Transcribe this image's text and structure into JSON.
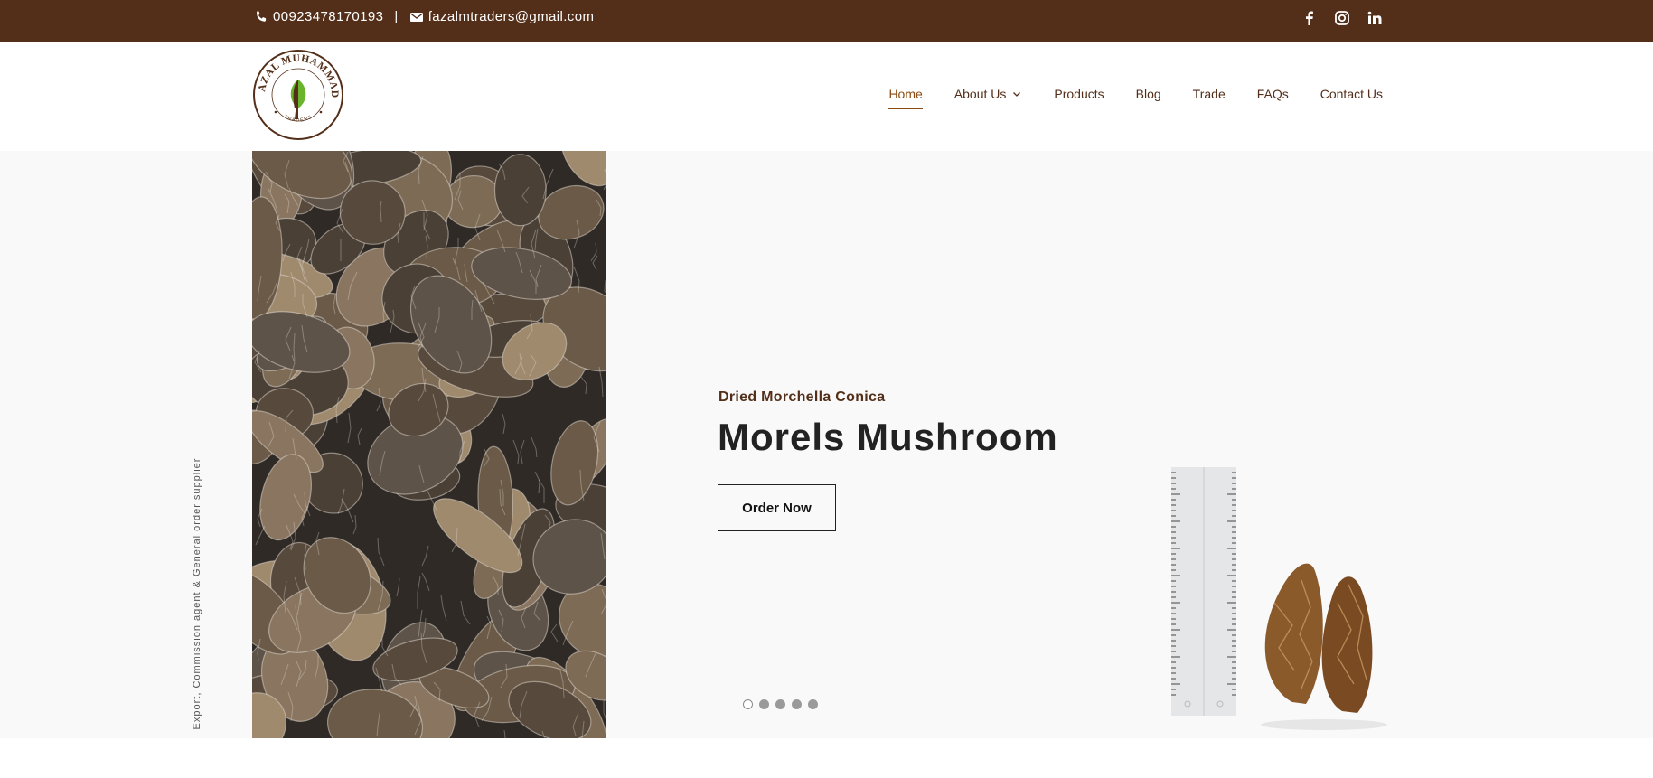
{
  "topbar": {
    "phone": "00923478170193",
    "separator": "|",
    "email": "fazalmtraders@gmail.com",
    "social": [
      "facebook-icon",
      "instagram-icon",
      "linkedin-icon"
    ]
  },
  "logo": {
    "top_text": "FAZAL MUHAMMAD",
    "bottom_text": "TRADERS"
  },
  "nav": {
    "items": [
      {
        "label": "Home",
        "active": true
      },
      {
        "label": "About Us",
        "has_dropdown": true
      },
      {
        "label": "Products"
      },
      {
        "label": "Blog"
      },
      {
        "label": "Trade"
      },
      {
        "label": "FAQs"
      },
      {
        "label": "Contact Us"
      }
    ]
  },
  "hero": {
    "side_text": "Export, Commission agent & General order supplier",
    "subtitle": "Dried Morchella Conica",
    "title": "Morels Mushroom",
    "button_label": "Order Now",
    "slide_count": 5,
    "active_slide": 1
  },
  "colors": {
    "topbar_bg": "#532f19",
    "accent": "#8a4a12",
    "hero_bg": "#f9f9f9",
    "leaf_green": "#6ab42d"
  }
}
